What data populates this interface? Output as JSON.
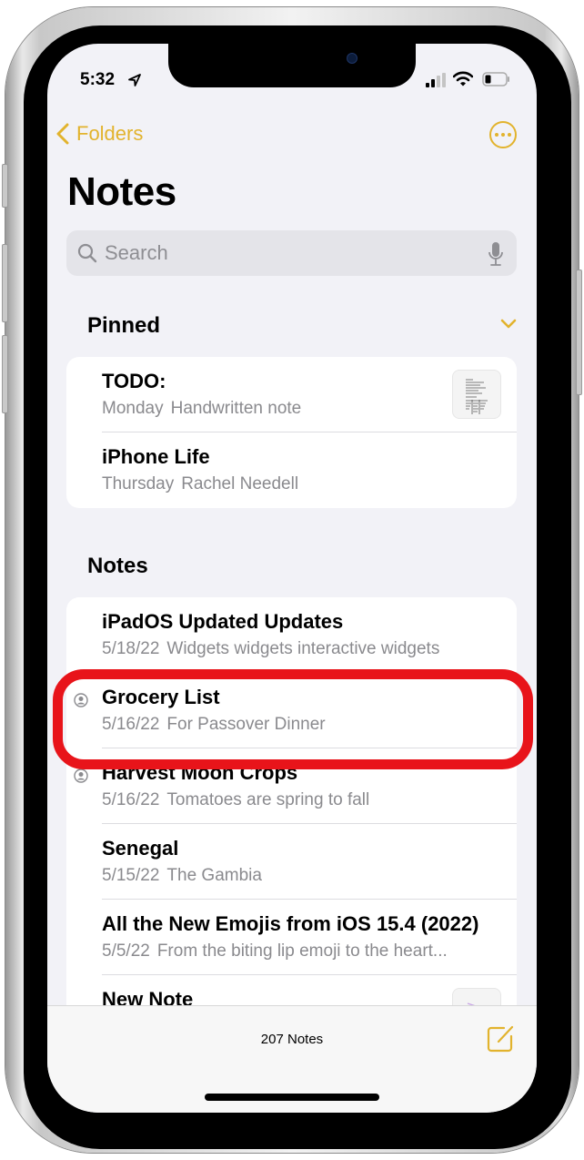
{
  "status_bar": {
    "time": "5:32"
  },
  "nav": {
    "back_label": "Folders"
  },
  "page": {
    "title": "Notes"
  },
  "search": {
    "placeholder": "Search"
  },
  "pinned": {
    "header": "Pinned",
    "notes": [
      {
        "title": "TODO:",
        "date": "Monday",
        "preview": "Handwritten note",
        "has_thumbnail": true,
        "shared": false
      },
      {
        "title": "iPhone Life",
        "date": "Thursday",
        "preview": "Rachel Needell",
        "has_thumbnail": false,
        "shared": false
      }
    ]
  },
  "notes": {
    "header": "Notes",
    "items": [
      {
        "title": "iPadOS Updated Updates",
        "date": "5/18/22",
        "preview": "Widgets widgets interactive widgets",
        "shared": false
      },
      {
        "title": "Grocery List",
        "date": "5/16/22",
        "preview": "For Passover Dinner",
        "shared": true,
        "highlighted": true
      },
      {
        "title": "Harvest Moon Crops",
        "date": "5/16/22",
        "preview": "Tomatoes are spring to fall",
        "shared": true
      },
      {
        "title": "Senegal",
        "date": "5/15/22",
        "preview": "The Gambia",
        "shared": false
      },
      {
        "title": "All the New Emojis from iOS 15.4 (2022)",
        "date": "5/5/22",
        "preview": "From the biting lip emoji to the heart...",
        "shared": false
      },
      {
        "title": "New Note",
        "date": "",
        "preview": "",
        "shared": false,
        "has_thumbnail": true
      }
    ]
  },
  "toolbar": {
    "count_label": "207 Notes"
  },
  "colors": {
    "accent": "#e2b32d",
    "highlight": "#e8141a",
    "background": "#f2f2f7",
    "secondary_text": "#8a8a8e"
  }
}
